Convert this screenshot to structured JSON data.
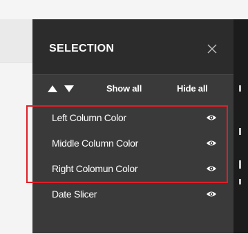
{
  "pane": {
    "title": "SELECTION",
    "toolbar": {
      "show_all_label": "Show all",
      "hide_all_label": "Hide all"
    },
    "items": [
      {
        "label": "Left Column Color",
        "visible": true
      },
      {
        "label": "Middle Column Color",
        "visible": true
      },
      {
        "label": "Right Colomun Color",
        "visible": true
      },
      {
        "label": "Date Slicer",
        "visible": true
      }
    ]
  },
  "icons": {
    "close": "close-icon",
    "move_up": "triangle-up-icon",
    "move_down": "triangle-down-icon",
    "visibility": "eye-icon"
  },
  "colors": {
    "pane_background": "#3a3a3a",
    "header_background": "#2c2c2c",
    "text": "#ffffff",
    "highlight": "#e01e27"
  }
}
